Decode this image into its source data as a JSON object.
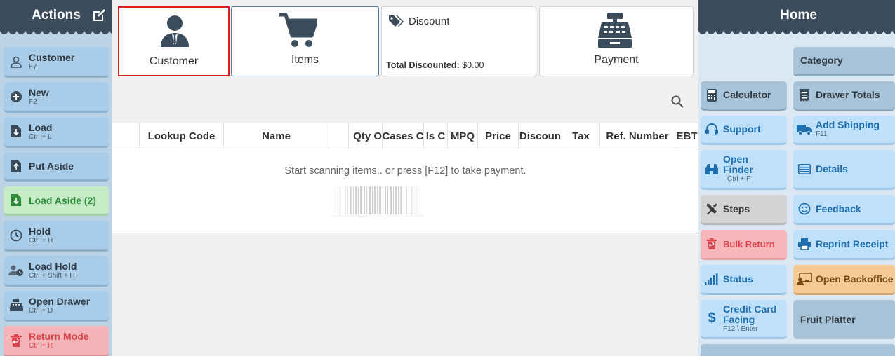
{
  "left_panel": {
    "title": "Actions",
    "buttons": [
      {
        "label": "Customer",
        "shortcut": "F7"
      },
      {
        "label": "New",
        "shortcut": "F2"
      },
      {
        "label": "Load",
        "shortcut": "Ctrl + L"
      },
      {
        "label": "Put Aside"
      },
      {
        "label": "Load Aside (2)"
      },
      {
        "label": "Hold",
        "shortcut": "Ctrl + H"
      },
      {
        "label": "Load Hold",
        "shortcut": "Ctrl + Shift + H"
      },
      {
        "label": "Open Drawer",
        "shortcut": "Ctrl + D"
      },
      {
        "label": "Return Mode",
        "shortcut": "Ctrl + R"
      }
    ]
  },
  "top_tiles": {
    "customer": "Customer",
    "items": "Items",
    "discount": {
      "title": "Discount",
      "total_label": "Total Discounted:",
      "total_value": "$0.00"
    },
    "payment": "Payment"
  },
  "grid": {
    "columns": [
      "",
      "Lookup Code",
      "Name",
      "",
      "Qty O",
      "Cases C",
      "Is C",
      "MPQ",
      "Price",
      "Discoun",
      "Tax",
      "Ref. Number",
      "EBT"
    ],
    "empty_message": "Start scanning items.. or press [F12] to take payment."
  },
  "right_panel": {
    "title": "Home",
    "buttons": {
      "category": "Category",
      "calculator": "Calculator",
      "drawer_totals": "Drawer Totals",
      "support": "Support",
      "add_shipping": "Add Shipping",
      "add_shipping_shortcut": "F11",
      "open_finder_1": "Open",
      "open_finder_2": "Finder",
      "open_finder_shortcut": "Ctrl + F",
      "details": "Details",
      "steps": "Steps",
      "feedback": "Feedback",
      "bulk_return": "Bulk Return",
      "reprint_receipt": "Reprint Receipt",
      "status": "Status",
      "open_backoffice": "Open Backoffice",
      "credit_card_1": "Credit Card",
      "credit_card_2": "Facing",
      "credit_card_shortcut": "F12 \\ Enter",
      "fruit_platter": "Fruit Platter"
    }
  }
}
